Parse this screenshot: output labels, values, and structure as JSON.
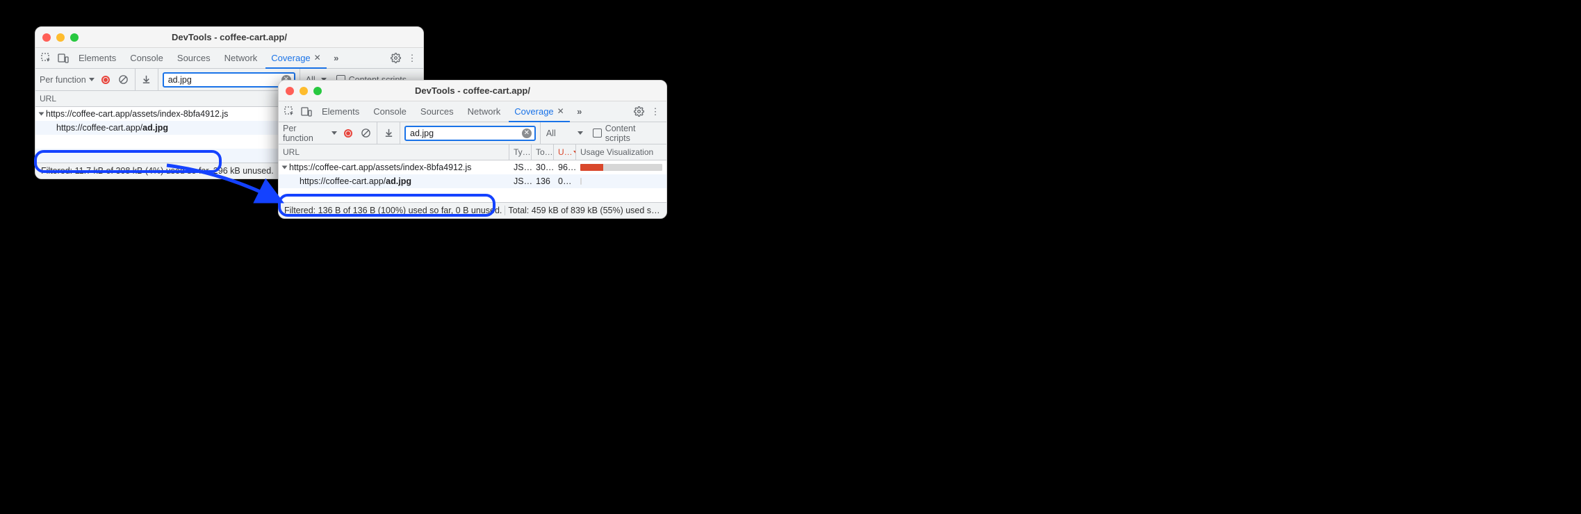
{
  "windowA": {
    "title": "DevTools - coffee-cart.app/",
    "tabs": {
      "elements": "Elements",
      "console": "Console",
      "sources": "Sources",
      "network": "Network",
      "coverage": "Coverage"
    },
    "toolbar": {
      "granularity": "Per function",
      "filter_value": "ad.jpg",
      "type_filter": "All",
      "content_scripts": "Content scripts"
    },
    "header": {
      "url": "URL"
    },
    "rows": [
      {
        "url_prefix": "https://coffee-cart.app/assets/index-8bfa4912.js",
        "url_bold": ""
      },
      {
        "url_prefix": "https://coffee-cart.app/",
        "url_bold": "ad.jpg"
      }
    ],
    "status": {
      "filtered": "Filtered: 11.7 kB of 308 kB (4%) used so far, 296 kB unused."
    }
  },
  "windowB": {
    "title": "DevTools - coffee-cart.app/",
    "tabs": {
      "elements": "Elements",
      "console": "Console",
      "sources": "Sources",
      "network": "Network",
      "coverage": "Coverage"
    },
    "toolbar": {
      "granularity": "Per function",
      "filter_value": "ad.jpg",
      "type_filter": "All",
      "content_scripts": "Content scripts"
    },
    "header": {
      "url": "URL",
      "type": "Ty…",
      "total": "To…",
      "unused": "U…",
      "viz": "Usage Visualization"
    },
    "rows": [
      {
        "url_prefix": "https://coffee-cart.app/assets/index-8bfa4912.js",
        "url_bold": "",
        "type": "JS…",
        "total": "30…",
        "unused": "96…",
        "bar_used": 28
      },
      {
        "url_prefix": "https://coffee-cart.app/",
        "url_bold": "ad.jpg",
        "type": "JS…",
        "total": "136",
        "unused": "0…",
        "bar_used": 2
      }
    ],
    "status": {
      "filtered": "Filtered: 136 B of 136 B (100%) used so far, 0 B unused.",
      "total": "Total: 459 kB of 839 kB (55%) used so far,…"
    }
  }
}
